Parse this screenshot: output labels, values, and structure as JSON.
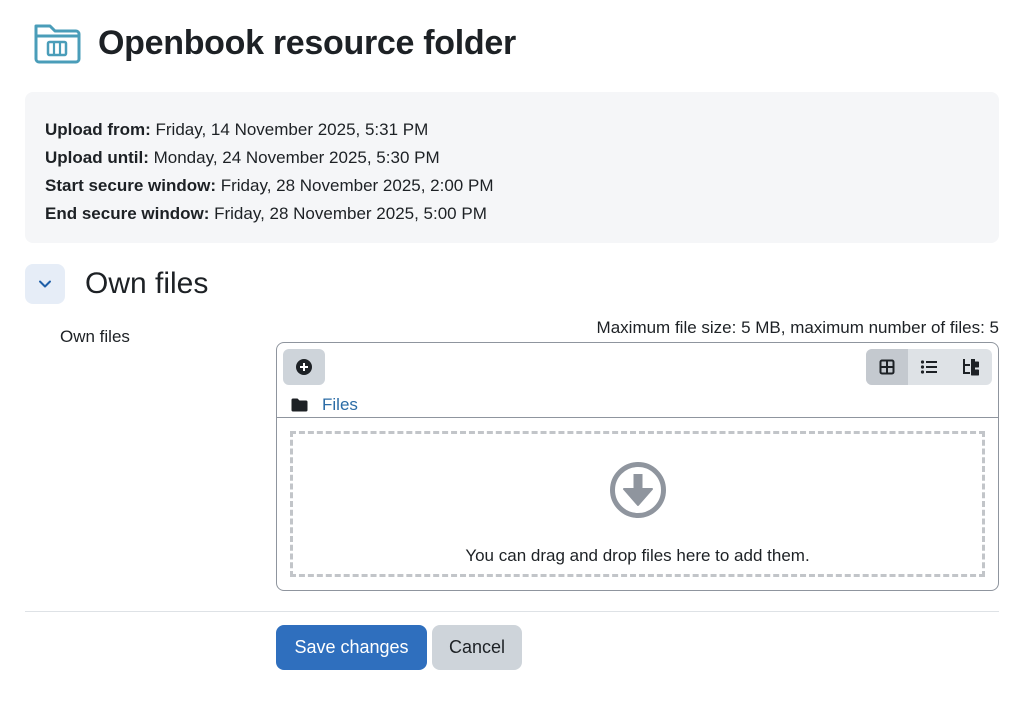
{
  "header": {
    "title": "Openbook resource folder",
    "icon": "folder-book-icon",
    "icon_color": "#4a9db9"
  },
  "info": {
    "rows": [
      {
        "label": "Upload from:",
        "value": "Friday, 14 November 2025, 5:31 PM"
      },
      {
        "label": "Upload until:",
        "value": "Monday, 24 November 2025, 5:30 PM"
      },
      {
        "label": "Start secure window:",
        "value": "Friday, 28 November 2025, 2:00 PM"
      },
      {
        "label": "End secure window:",
        "value": "Friday, 28 November 2025, 5:00 PM"
      }
    ]
  },
  "section": {
    "title": "Own files",
    "collapse_icon": "chevron-down-icon"
  },
  "form": {
    "field_label": "Own files",
    "limits": "Maximum file size: 5 MB, maximum number of files: 5",
    "path": "Files",
    "drop_text": "You can drag and drop files here to add them.",
    "views": [
      "grid-view-icon",
      "list-view-icon",
      "tree-view-icon"
    ],
    "active_view": "grid-view-icon"
  },
  "buttons": {
    "save": "Save changes",
    "cancel": "Cancel"
  },
  "colors": {
    "primary": "#2f6fbe",
    "link": "#2b6ca6",
    "panel_bg": "#f5f6f8"
  }
}
